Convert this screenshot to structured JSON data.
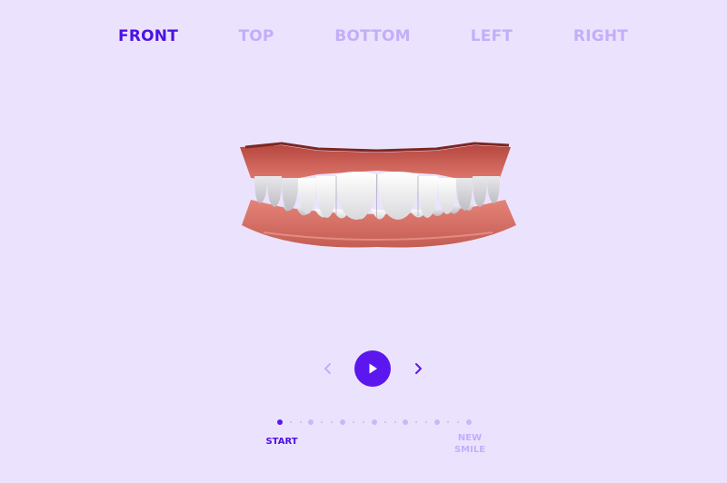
{
  "view_tabs": [
    {
      "label": "FRONT",
      "active": true
    },
    {
      "label": "TOP",
      "active": false
    },
    {
      "label": "BOTTOM",
      "active": false
    },
    {
      "label": "LEFT",
      "active": false
    },
    {
      "label": "RIGHT",
      "active": false
    }
  ],
  "model": {
    "view": "front"
  },
  "player": {
    "prev_icon": "chevron-left-icon",
    "play_icon": "play-icon",
    "next_icon": "chevron-right-icon"
  },
  "timeline": {
    "step_count": 7,
    "current_step": 1,
    "start_label": "START",
    "end_label_line1": "NEW",
    "end_label_line2": "SMILE"
  },
  "colors": {
    "background": "#ebe3fd",
    "accent": "#5b17ee",
    "active_tab": "#4d12e6",
    "inactive": "#c3aef9"
  }
}
